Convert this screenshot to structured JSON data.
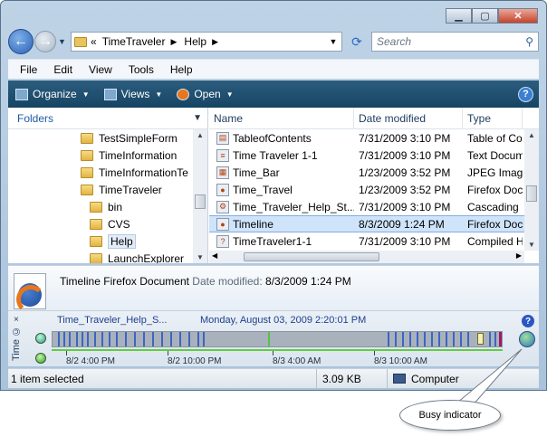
{
  "window": {
    "minimize_icon": "minimize-icon",
    "maximize_icon": "maximize-icon",
    "close_icon": "close-icon"
  },
  "address": {
    "prefix": "«",
    "segments": [
      "TimeTraveler",
      "Help"
    ],
    "search_placeholder": "Search"
  },
  "menu": [
    "File",
    "Edit",
    "View",
    "Tools",
    "Help"
  ],
  "toolbar": {
    "organize": "Organize",
    "views": "Views",
    "open": "Open",
    "help": "?"
  },
  "folders": {
    "header": "Folders",
    "items": [
      {
        "label": "TestSimpleForm",
        "indent": 1
      },
      {
        "label": "TimeInformation",
        "indent": 1
      },
      {
        "label": "TimeInformationTe",
        "indent": 1
      },
      {
        "label": "TimeTraveler",
        "indent": 1
      },
      {
        "label": "bin",
        "indent": 2
      },
      {
        "label": "CVS",
        "indent": 2
      },
      {
        "label": "Help",
        "indent": 2,
        "selected": true
      },
      {
        "label": "LaunchExplorer",
        "indent": 2
      }
    ]
  },
  "files": {
    "columns": {
      "name": "Name",
      "date": "Date modified",
      "type": "Type"
    },
    "rows": [
      {
        "name": "TableofContents",
        "date": "7/31/2009 3:10 PM",
        "type": "Table of Co",
        "icon": "book-icon"
      },
      {
        "name": "Time Traveler 1-1",
        "date": "7/31/2009 3:10 PM",
        "type": "Text Docum",
        "icon": "text-file-icon"
      },
      {
        "name": "Time_Bar",
        "date": "1/23/2009 3:52 PM",
        "type": "JPEG Image",
        "icon": "image-file-icon"
      },
      {
        "name": "Time_Travel",
        "date": "1/23/2009 3:52 PM",
        "type": "Firefox Doc",
        "icon": "firefox-file-icon"
      },
      {
        "name": "Time_Traveler_Help_St...",
        "date": "7/31/2009 3:10 PM",
        "type": "Cascading",
        "icon": "css-file-icon"
      },
      {
        "name": "Timeline",
        "date": "8/3/2009 1:24 PM",
        "type": "Firefox Doc",
        "icon": "firefox-file-icon",
        "selected": true
      },
      {
        "name": "TimeTraveler1-1",
        "date": "7/31/2009 3:10 PM",
        "type": "Compiled H",
        "icon": "help-file-icon"
      }
    ]
  },
  "details": {
    "name": "Timeline",
    "kind": "Firefox Document",
    "date_label": "Date modified:",
    "date_value": "8/3/2009 1:24 PM"
  },
  "timebar": {
    "label": "Time ©",
    "close": "×",
    "file": "Time_Traveler_Help_S...",
    "datetime": "Monday, August 03, 2009 2:20:01 PM",
    "ticks": [
      "8/2 4:00 PM",
      "8/2 10:00 PM",
      "8/3 4:00 AM",
      "8/3 10:00 AM"
    ],
    "help": "?"
  },
  "status": {
    "selection": "1 item selected",
    "size": "3.09 KB",
    "location": "Computer"
  },
  "callout": {
    "text": "Busy indicator"
  }
}
